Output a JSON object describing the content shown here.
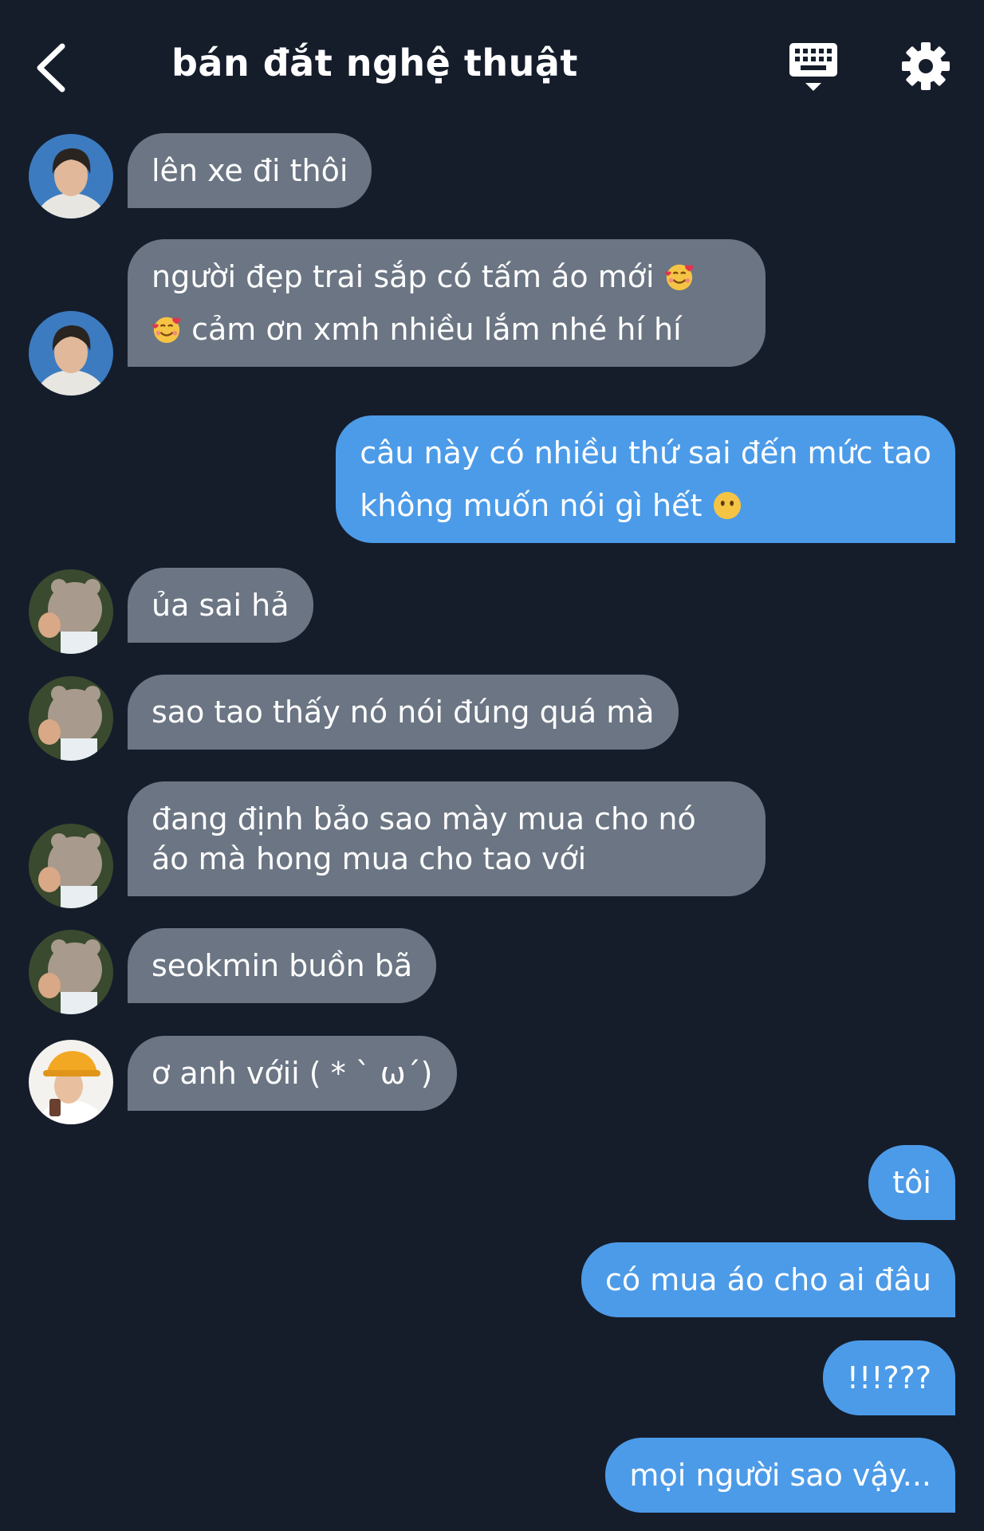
{
  "header": {
    "title": "bán đắt nghệ thuật",
    "back_icon": "chevron-left-icon",
    "keyboard_icon": "keyboard-icon",
    "settings_icon": "gear-icon"
  },
  "colors": {
    "background": "#151d2b",
    "incoming_bubble": "#6b7583",
    "outgoing_bubble": "#4c9be8"
  },
  "messages": [
    {
      "side": "incoming",
      "avatar": "avatar-dark-hair",
      "lines": [
        "lên xe đi thôi"
      ]
    },
    {
      "side": "incoming",
      "avatar": "avatar-dark-hair",
      "lines": [
        "người đẹp trai sắp có tấm áo mới",
        "cảm ơn xmh nhiều lắm nhé hí hí"
      ],
      "emoji": "smiling-face-with-hearts"
    },
    {
      "side": "outgoing",
      "lines": [
        "câu này có nhiều thứ sai đến mức tao",
        "không muốn nói gì hết"
      ],
      "emoji": "face-without-mouth"
    },
    {
      "side": "incoming",
      "avatar": "avatar-teddy-bear",
      "lines": [
        "ủa sai hả"
      ]
    },
    {
      "side": "incoming",
      "avatar": "avatar-teddy-bear",
      "lines": [
        "sao tao thấy nó nói đúng quá mà"
      ]
    },
    {
      "side": "incoming",
      "avatar": "avatar-teddy-bear",
      "lines": [
        "đang định bảo sao mày mua cho nó",
        "áo mà hong mua cho tao với"
      ]
    },
    {
      "side": "incoming",
      "avatar": "avatar-teddy-bear",
      "lines": [
        "seokmin buồn bã"
      ]
    },
    {
      "side": "incoming",
      "avatar": "avatar-yellow-hat",
      "lines": [
        "ơ anh vớii ( * ` ω´)"
      ]
    },
    {
      "side": "outgoing",
      "lines": [
        "tôi"
      ]
    },
    {
      "side": "outgoing",
      "lines": [
        "có mua áo cho ai đâu"
      ]
    },
    {
      "side": "outgoing",
      "lines": [
        "!!!???"
      ]
    },
    {
      "side": "outgoing",
      "lines": [
        "mọi người sao vậy..."
      ]
    }
  ]
}
